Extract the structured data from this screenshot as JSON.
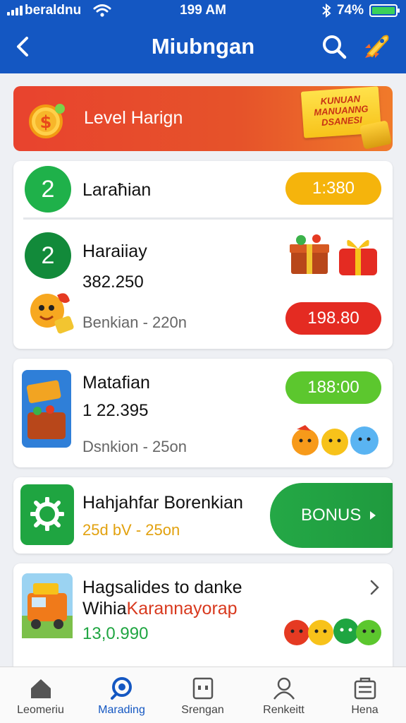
{
  "status_bar": {
    "carrier": "beraldnu",
    "time": "199 AM",
    "battery": "74%"
  },
  "nav": {
    "title": "Miubngan"
  },
  "banner": {
    "label": "Level Harign",
    "ribbon_lines": [
      "KUNUAN",
      "MANUANNG",
      "DSANESI"
    ]
  },
  "items": [
    {
      "rank": "2",
      "name": "Laraħian",
      "price": "1:380"
    },
    {
      "rank": "2",
      "name": "Haraiiay",
      "amount": "382.250",
      "subtitle": "Benkian - 220n",
      "price": "198.80"
    },
    {
      "name": "Matafian",
      "amount": "1 22.395",
      "subtitle": "Dsnkion - 25on",
      "price": "188:00"
    },
    {
      "name": "Hahjahfar Borenkian",
      "subtitle": "25d bV - 25on",
      "bonus_label": "BONUS"
    },
    {
      "name": "Hagsalides to danke",
      "name2_dark": "Wihia",
      "name2_red": "Karannayorap",
      "amount": "13,0.990"
    }
  ],
  "tabs": [
    {
      "label": "Leomeriu",
      "icon": "home-icon"
    },
    {
      "label": "Marading",
      "icon": "discover-icon"
    },
    {
      "label": "Srengan",
      "icon": "wallet-icon"
    },
    {
      "label": "Renkeitt",
      "icon": "profile-icon"
    },
    {
      "label": "Hena",
      "icon": "list-icon"
    }
  ],
  "colors": {
    "primary": "#1457c2",
    "green": "#1fa541",
    "orange": "#f5b40c",
    "red": "#e42b22",
    "lime": "#5cc72e"
  }
}
